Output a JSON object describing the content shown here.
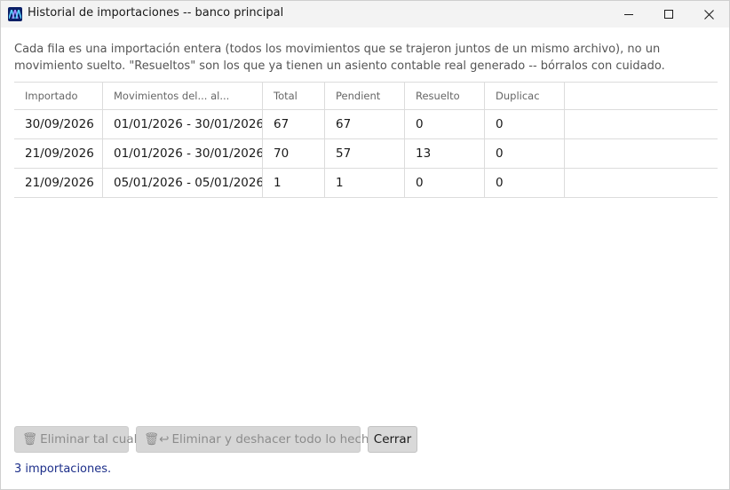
{
  "window": {
    "title": "Historial de importaciones -- banco principal",
    "app_icon": "app-logo-icon"
  },
  "description": "Cada fila es una importación entera (todos los movimientos que se trajeron juntos de un mismo archivo), no un movimiento suelto. \"Resueltos\" son los que ya tienen un asiento contable real generado -- bórralos con cuidado.",
  "table": {
    "columns": [
      "Importado",
      "Movimientos del... al...",
      "Total",
      "Pendient",
      "Resuelto",
      "Duplicac"
    ],
    "rows": [
      [
        "30/09/2026",
        "01/01/2026 - 30/01/2026",
        "67",
        "67",
        "0",
        "0"
      ],
      [
        "21/09/2026",
        "01/01/2026 - 30/01/2026",
        "70",
        "57",
        "13",
        "0"
      ],
      [
        "21/09/2026",
        "05/01/2026 - 05/01/2026",
        "1",
        "1",
        "0",
        "0"
      ]
    ]
  },
  "buttons": {
    "delete": {
      "icon": "trash-icon",
      "glyph": "🗑",
      "label": "Eliminar tal cual"
    },
    "undo": {
      "icon": "trash-undo-icon",
      "glyph": "🗑↩",
      "label": "Eliminar y deshacer todo lo hecho"
    },
    "close": {
      "label": "Cerrar"
    }
  },
  "status": "3 importaciones.",
  "colors": {
    "status_text": "#1d2f8a",
    "app_icon_bg": "#0b1f66",
    "grid_line": "#dcdcdc"
  }
}
